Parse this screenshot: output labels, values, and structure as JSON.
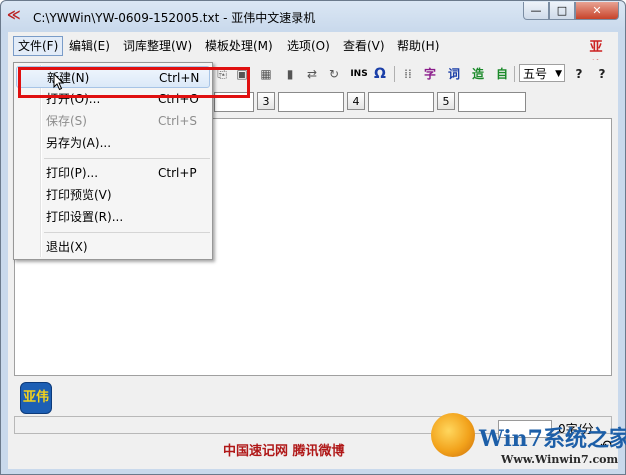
{
  "window": {
    "title": "C:\\YWWin\\YW-0609-152005.txt - 亚伟中文速录机",
    "minimize": "—",
    "maximize": "□",
    "close": "✕"
  },
  "menubar": [
    {
      "label": "文件(F)"
    },
    {
      "label": "编辑(E)"
    },
    {
      "label": "词库整理(W)"
    },
    {
      "label": "模板处理(M)"
    },
    {
      "label": "选项(O)"
    },
    {
      "label": "查看(V)"
    },
    {
      "label": "帮助(H)"
    }
  ],
  "menu_logo": "亚伟",
  "toolbar": {
    "ins_label": "INS",
    "omega": "Ω",
    "char_zi": "字",
    "char_ci": "词",
    "char_zao": "造",
    "char_zi2": "自",
    "font_size": "五号",
    "help_icon": "?",
    "context_help_icon": "?"
  },
  "input_row": {
    "buttons": [
      "3",
      "4",
      "5"
    ]
  },
  "file_menu": {
    "items": [
      {
        "label": "新建(N)",
        "shortcut": "Ctrl+N",
        "disabled": false
      },
      {
        "label": "打开(O)...",
        "shortcut": "Ctrl+O",
        "disabled": false
      },
      {
        "label": "保存(S)",
        "shortcut": "Ctrl+S",
        "disabled": true
      },
      {
        "label": "另存为(A)...",
        "shortcut": "",
        "disabled": false
      },
      {
        "label": "打印(P)...",
        "shortcut": "Ctrl+P",
        "disabled": false
      },
      {
        "label": "打印预览(V)",
        "shortcut": "",
        "disabled": false
      },
      {
        "label": "打印设置(R)...",
        "shortcut": "",
        "disabled": false
      },
      {
        "label": "退出(X)",
        "shortcut": "",
        "disabled": false
      }
    ]
  },
  "bottom_logo": "亚伟",
  "status": {
    "char_count": "0字/分",
    "footer": "中国速记网 腾讯微博"
  },
  "watermark": {
    "text": "Win7系统之家",
    "url": "Www.Winwin7.com"
  },
  "colors": {
    "highlight": "#e01010",
    "footer_text": "#b01818",
    "menu_hover": "#dbe9f8"
  }
}
